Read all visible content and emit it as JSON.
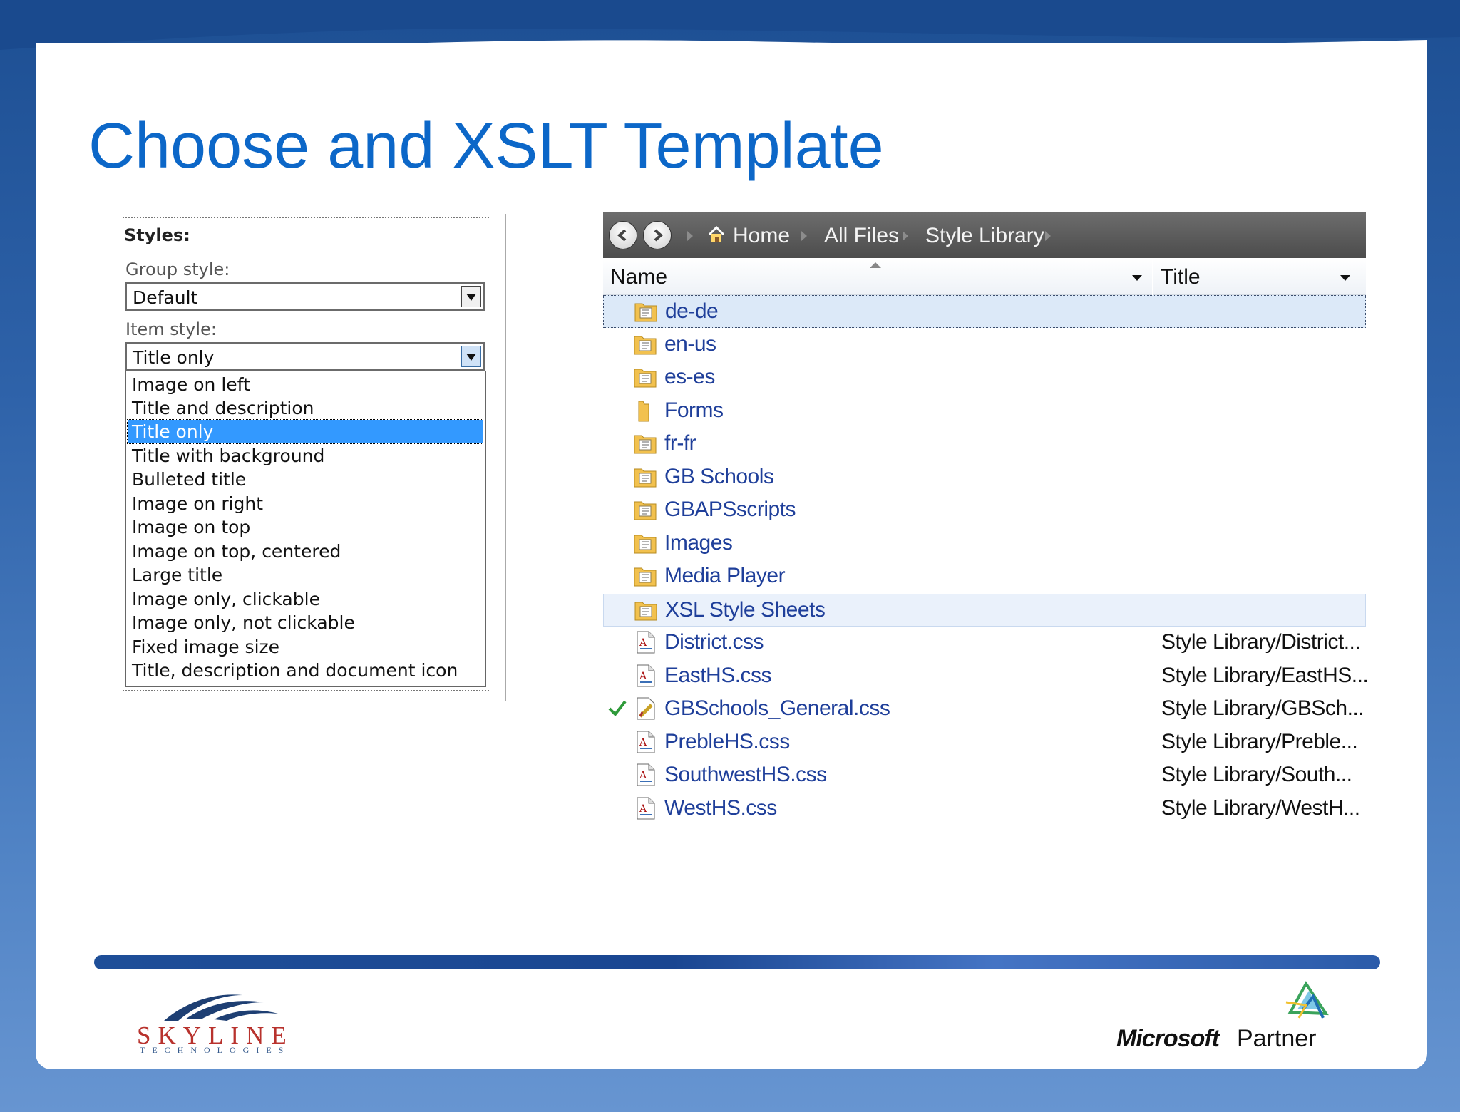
{
  "slide": {
    "title": "Choose and XSLT Template"
  },
  "styles_panel": {
    "heading": "Styles:",
    "group_style": {
      "label": "Group style:",
      "value": "Default"
    },
    "item_style": {
      "label": "Item style:",
      "value": "Title only"
    },
    "options": [
      "Image on left",
      "Title and description",
      "Title only",
      "Title with background",
      "Bulleted title",
      "Image on right",
      "Image on top",
      "Image on top, centered",
      "Large title",
      "Image only, clickable",
      "Image only, not clickable",
      "Fixed image size",
      "Title, description and document icon"
    ],
    "selected_option": "Title only"
  },
  "explorer": {
    "breadcrumbs": [
      "Home",
      "All Files",
      "Style Library"
    ],
    "columns": {
      "name": "Name",
      "title": "Title"
    },
    "folders": [
      "de-de",
      "en-us",
      "es-es",
      "Forms",
      "fr-fr",
      "GB Schools",
      "GBAPSscripts",
      "Images",
      "Media Player",
      "XSL Style Sheets"
    ],
    "files": [
      {
        "name": "District.css",
        "title": "Style Library/District..."
      },
      {
        "name": "EastHS.css",
        "title": "Style Library/EastHS..."
      },
      {
        "name": "GBSchools_General.css",
        "title": "Style Library/GBSch..."
      },
      {
        "name": "PrebleHS.css",
        "title": "Style Library/Preble..."
      },
      {
        "name": "SouthwestHS.css",
        "title": "Style Library/South..."
      },
      {
        "name": "WestHS.css",
        "title": "Style Library/WestH..."
      }
    ]
  },
  "footer": {
    "skyline_name": "SKYLINE",
    "skyline_sub": "TECHNOLOGIES",
    "ms_word": "Microsoft",
    "partner_word": "Partner"
  },
  "colors": {
    "title": "#0c67c8",
    "selection": "#3399ff",
    "link": "#1f3f9a",
    "brand_red": "#b8322d"
  }
}
